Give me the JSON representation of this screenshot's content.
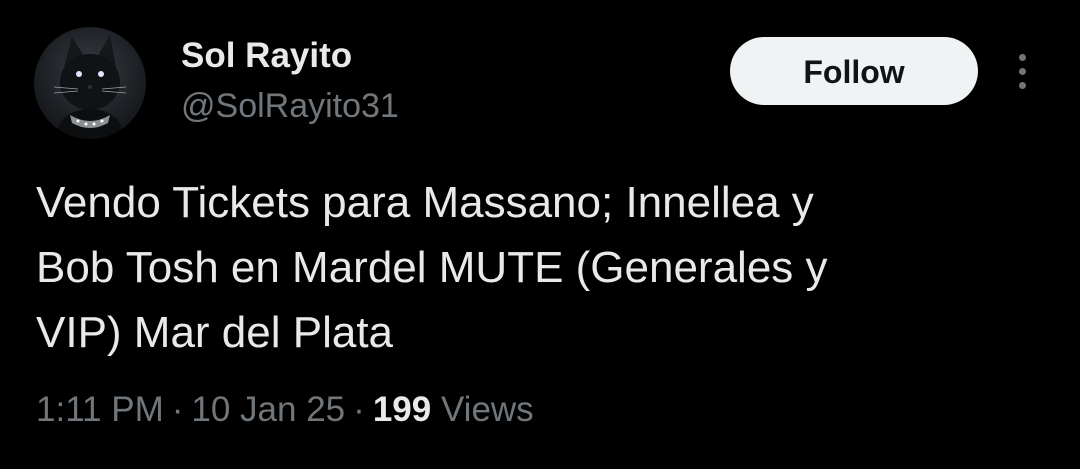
{
  "colors": {
    "background": "#000000",
    "primary_text": "#e7e9ea",
    "secondary_text": "#71767b",
    "follow_button_bg": "#eff3f4",
    "follow_button_text": "#0f1419"
  },
  "author": {
    "display_name": "Sol Rayito",
    "handle": "@SolRayito31",
    "avatar_icon": "black-cat-avatar"
  },
  "actions": {
    "follow_label": "Follow",
    "more_icon": "more-vertical-icon"
  },
  "tweet": {
    "text": "Vendo Tickets para Massano; Innellea y\nBob Tosh en Mardel MUTE (Generales y\nVIP) Mar del Plata"
  },
  "meta": {
    "time": "1:11 PM",
    "date": "10 Jan 25",
    "separator": "·",
    "views_count": "199",
    "views_label": "Views"
  }
}
